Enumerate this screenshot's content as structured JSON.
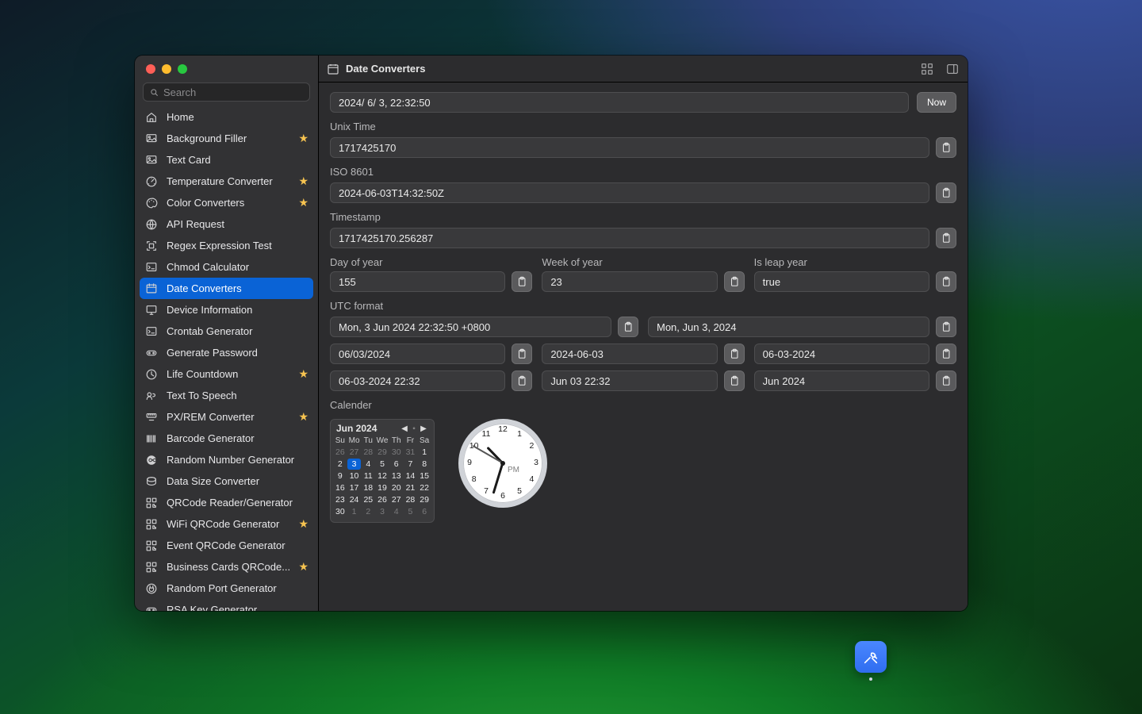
{
  "search": {
    "placeholder": "Search"
  },
  "sidebar": {
    "items": [
      {
        "label": "Home",
        "starred": false,
        "icon": "home-icon"
      },
      {
        "label": "Background Filler",
        "starred": true,
        "icon": "image-icon"
      },
      {
        "label": "Text Card",
        "starred": false,
        "icon": "image-icon"
      },
      {
        "label": "Temperature Converter",
        "starred": true,
        "icon": "gauge-icon"
      },
      {
        "label": "Color Converters",
        "starred": true,
        "icon": "palette-icon"
      },
      {
        "label": "API Request",
        "starred": false,
        "icon": "globe-icon"
      },
      {
        "label": "Regex Expression Test",
        "starred": false,
        "icon": "scan-icon"
      },
      {
        "label": "Chmod Calculator",
        "starred": false,
        "icon": "terminal-icon"
      },
      {
        "label": "Date Converters",
        "starred": false,
        "icon": "calendar-icon"
      },
      {
        "label": "Device Information",
        "starred": false,
        "icon": "display-icon"
      },
      {
        "label": "Crontab Generator",
        "starred": false,
        "icon": "terminal-icon"
      },
      {
        "label": "Generate Password",
        "starred": false,
        "icon": "key-icon"
      },
      {
        "label": "Life Countdown",
        "starred": true,
        "icon": "clock-icon"
      },
      {
        "label": "Text To Speech",
        "starred": false,
        "icon": "speech-icon"
      },
      {
        "label": "PX/REM Converter",
        "starred": true,
        "icon": "ruler-icon"
      },
      {
        "label": "Barcode Generator",
        "starred": false,
        "icon": "barcode-icon"
      },
      {
        "label": "Random Number Generator",
        "starred": false,
        "icon": "infinity-icon"
      },
      {
        "label": "Data Size Converter",
        "starred": false,
        "icon": "disk-icon"
      },
      {
        "label": "QRCode Reader/Generator",
        "starred": false,
        "icon": "qrcode-icon"
      },
      {
        "label": "WiFi QRCode Generator",
        "starred": true,
        "icon": "qrcode-icon"
      },
      {
        "label": "Event QRCode Generator",
        "starred": false,
        "icon": "qrcode-icon"
      },
      {
        "label": "Business Cards QRCode...",
        "starred": true,
        "icon": "qrcode-icon"
      },
      {
        "label": "Random Port Generator",
        "starred": false,
        "icon": "plug-icon"
      },
      {
        "label": "RSA Key Generator",
        "starred": false,
        "icon": "key-icon"
      }
    ],
    "activeIndex": 8
  },
  "header": {
    "title": "Date Converters"
  },
  "toolbar": {
    "now": "Now"
  },
  "main": {
    "date_input": "2024/  6/  3, 22:32:50",
    "sections": {
      "unix": {
        "label": "Unix Time",
        "value": "1717425170"
      },
      "iso": {
        "label": "ISO 8601",
        "value": "2024-06-03T14:32:50Z"
      },
      "ts": {
        "label": "Timestamp",
        "value": "1717425170.256287"
      },
      "doy": {
        "label": "Day of year",
        "value": "155"
      },
      "woy": {
        "label": "Week of year",
        "value": "23"
      },
      "leap": {
        "label": "Is leap year",
        "value": "true"
      },
      "utc": {
        "label": "UTC format",
        "value1": "Mon, 3 Jun 2024 22:32:50 +0800",
        "value2": "Mon, Jun 3, 2024"
      },
      "calendar_label": "Calender"
    },
    "formats": {
      "r1": [
        "06/03/2024",
        "2024-06-03",
        "06-03-2024"
      ],
      "r2": [
        "06-03-2024 22:32",
        "Jun 03 22:32",
        "Jun 2024"
      ]
    }
  },
  "calendar": {
    "month_label": "Jun 2024",
    "dow": [
      "Su",
      "Mo",
      "Tu",
      "We",
      "Th",
      "Fr",
      "Sa"
    ],
    "leading": [
      26,
      27,
      28,
      29,
      30,
      31
    ],
    "days": [
      1,
      2,
      3,
      4,
      5,
      6,
      7,
      8,
      9,
      10,
      11,
      12,
      13,
      14,
      15,
      16,
      17,
      18,
      19,
      20,
      21,
      22,
      23,
      24,
      25,
      26,
      27,
      28,
      29,
      30
    ],
    "trailing": [
      1,
      2,
      3,
      4,
      5,
      6
    ],
    "today": 3
  },
  "clock": {
    "ampm": "PM",
    "numerals": [
      "12",
      "1",
      "2",
      "3",
      "4",
      "5",
      "6",
      "7",
      "8",
      "9",
      "10",
      "11"
    ]
  }
}
